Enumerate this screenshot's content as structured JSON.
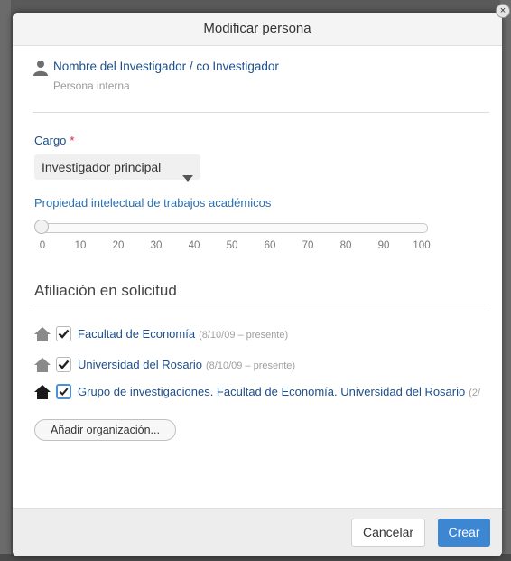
{
  "dialog": {
    "title": "Modificar persona",
    "close_glyph": "×"
  },
  "person": {
    "icon": "person-icon",
    "name": "Nombre del Investigador / co Investigador",
    "type": "Persona interna"
  },
  "cargo": {
    "label": "Cargo",
    "required_mark": "*",
    "selected": "Investigador principal"
  },
  "property": {
    "label": "Propiedad intelectual de trabajos académicos",
    "value": 0,
    "ticks": [
      "0",
      "10",
      "20",
      "30",
      "40",
      "50",
      "60",
      "70",
      "80",
      "90",
      "100"
    ]
  },
  "affiliation": {
    "title": "Afiliación en solicitud",
    "items": [
      {
        "name": "Facultad de Economía",
        "date": "(8/10/09 – presente)",
        "checked": true
      },
      {
        "name": "Universidad del Rosario",
        "date": "(8/10/09 – presente)",
        "checked": true
      },
      {
        "name": "Grupo de investigaciones. Facultad de Economía. Universidad del Rosario",
        "date": "(2/",
        "checked": true
      }
    ],
    "add_label": "Añadir organización..."
  },
  "footer": {
    "cancel_label": "Cancelar",
    "create_label": "Crear"
  },
  "colors": {
    "accent": "#3d86d2",
    "link": "#1e4f8a",
    "required": "#e0192b"
  }
}
